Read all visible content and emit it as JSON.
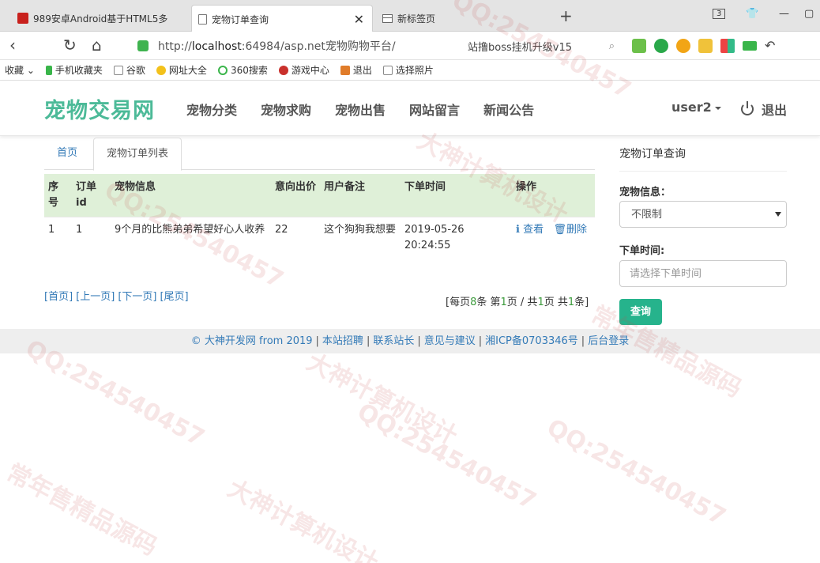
{
  "browser": {
    "tabs": [
      {
        "title": "989安卓Android基于HTML5多"
      },
      {
        "title": "宠物订单查询"
      },
      {
        "title": "新标签页"
      }
    ],
    "tab_count": "3",
    "url_prefix": "http://",
    "url_host": "localhost",
    "url_rest": ":64984/asp.net宠物购物平台/",
    "search_text": "站撸boss挂机升级v15",
    "bookmarks": [
      "收藏",
      "手机收藏夹",
      "谷歌",
      "网址大全",
      "360搜索",
      "游戏中心",
      "退出",
      "选择照片"
    ]
  },
  "site": {
    "brand": "宠物交易网",
    "menu": [
      "宠物分类",
      "宠物求购",
      "宠物出售",
      "网站留言",
      "新闻公告"
    ],
    "user": "user2",
    "logout": "退出"
  },
  "content": {
    "tabs": {
      "home": "首页",
      "active": "宠物订单列表"
    },
    "table": {
      "headers": [
        "序号",
        "订单id",
        "宠物信息",
        "意向出价",
        "用户备注",
        "下单时间",
        "操作"
      ],
      "rows": [
        {
          "index": "1",
          "order_id": "1",
          "pet_info": "9个月的比熊弟弟希望好心人收养",
          "price": "22",
          "remark": "这个狗狗我想要",
          "time": "2019-05-26 20:24:55",
          "view": "查看",
          "delete": "删除"
        }
      ]
    },
    "pager": {
      "first": "[首页]",
      "prev": "[上一页]",
      "next": "[下一页]",
      "last": "[尾页]",
      "info_prefix": "[每页",
      "per_page": "8",
      "info_mid1": "条 第",
      "page": "1",
      "info_mid2": "页 / 共",
      "total_pages": "1",
      "info_mid3": "页 共",
      "total_items": "1",
      "info_suffix": "条]"
    }
  },
  "sidebar": {
    "title": "宠物订单查询",
    "pet_label": "宠物信息：",
    "pet_selected": "不限制",
    "time_label": "下单时间:",
    "time_placeholder": "请选择下单时间",
    "query_button": "查询"
  },
  "footer": {
    "copyright": "© 大神开发网 from 2019",
    "links": [
      "本站招聘",
      "联系站长",
      "意见与建议",
      "湘ICP备0703346号",
      "后台登录"
    ]
  },
  "watermark": {
    "texts": [
      "QQ:254540457",
      "大神计算机设计",
      "常年售精品源码"
    ]
  },
  "colors": {
    "brand": "#4cba98",
    "link": "#337ab7",
    "table_header": "#dff0d8",
    "button": "#26b38c"
  }
}
